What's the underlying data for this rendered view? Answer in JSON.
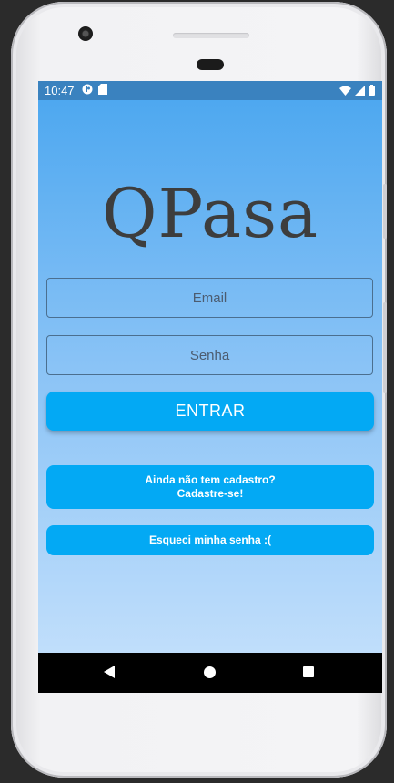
{
  "status_bar": {
    "time": "10:47",
    "icons": [
      "app-notification-icon",
      "sd-card-icon",
      "wifi-icon",
      "cell-signal-icon",
      "battery-icon"
    ]
  },
  "app": {
    "logo": "QPasa",
    "email_placeholder": "Email",
    "password_placeholder": "Senha",
    "login_label": "ENTRAR",
    "signup_line1": "Ainda não tem cadastro?",
    "signup_line2": "Cadastre-se!",
    "forgot_label": "Esqueci minha senha :("
  },
  "colors": {
    "accent": "#03a9f4",
    "status_bar": "#3a82bf",
    "gradient_top": "#4ea8f0",
    "gradient_bottom": "#c0defb",
    "logo": "#3d3d3d"
  },
  "nav_bar": {
    "icons": [
      "back-icon",
      "home-icon",
      "recents-icon"
    ]
  }
}
